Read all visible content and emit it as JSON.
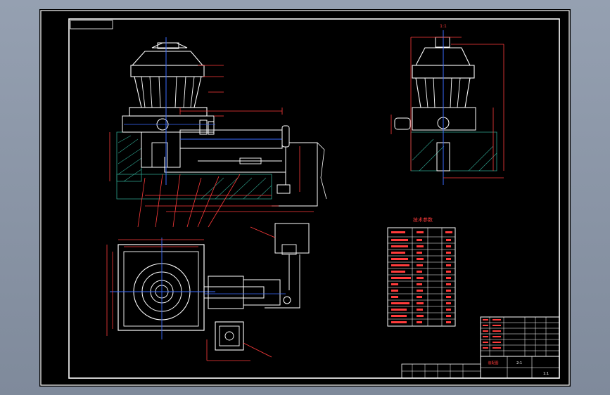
{
  "drawing": {
    "view_label": "1:1",
    "table_heading": "技术参数",
    "title_block": {
      "caption": "装配图",
      "drawing_no": "2:1",
      "scale_text": "1:1"
    }
  },
  "colors": {
    "background": "#000000",
    "frame": "#ffffff",
    "dimension": "#ff3b3b",
    "centerline": "#3a6bff",
    "hatch": "#2fa58f",
    "outline": "#ffffff"
  }
}
